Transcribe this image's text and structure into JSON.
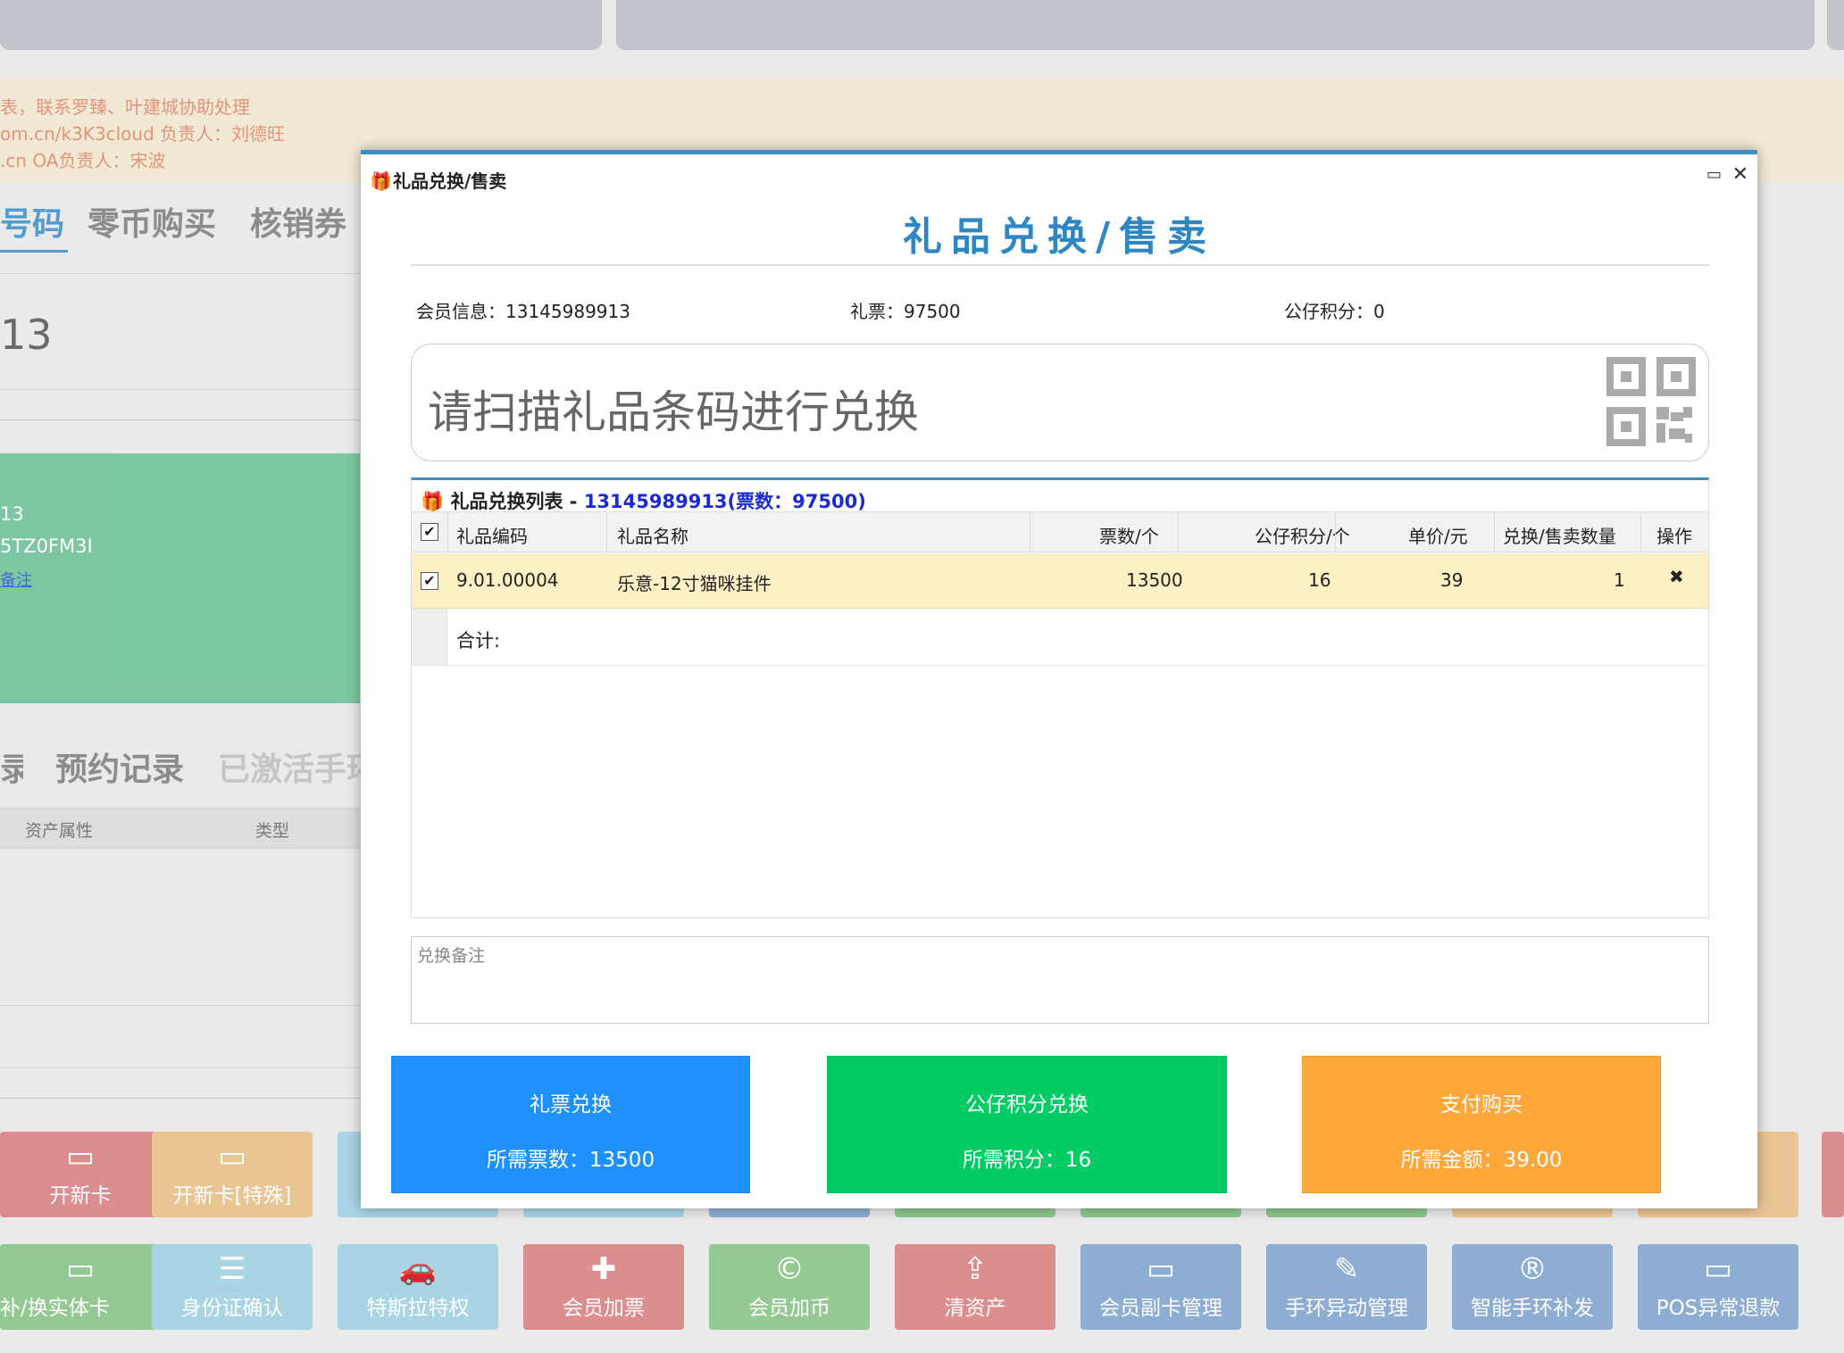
{
  "background": {
    "notice_lines": [
      "表，联系罗臻、叶建城协助处理",
      "om.cn/k3K3cloud 负责人：刘德旺",
      ".cn OA负责人：宋波"
    ],
    "top_tabs": [
      "号码",
      "零币购买",
      "核销券"
    ],
    "member_number_fragment": "13",
    "green_card_lines": [
      "13",
      "5TZ0FM3I"
    ],
    "green_card_link": "备注",
    "record_tabs": [
      "录",
      "预约记录",
      "已激活手环"
    ],
    "table_headers": [
      "资产属性",
      "类型"
    ],
    "tiles_row1": [
      "开新卡",
      "开新卡[特殊]"
    ],
    "tiles_row2": [
      "补/换实体卡",
      "身份证确认",
      "特斯拉特权",
      "会员加票",
      "会员加币",
      "清资产",
      "会员副卡管理",
      "手环异动管理",
      "智能手环补发",
      "POS异常退款"
    ]
  },
  "modal": {
    "window_title": "礼品兑换/售卖",
    "heading": "礼品兑换/售卖",
    "member_info_label": "会员信息：",
    "member_info_value": "13145989913",
    "ticket_label": "礼票：",
    "ticket_value": "97500",
    "points_label": "公仔积分：",
    "points_value": "0",
    "scan_placeholder": "请扫描礼品条码进行兑换",
    "list_title_prefix": "礼品兑换列表 - ",
    "list_title_highlight": "13145989913(票数：97500)",
    "columns": [
      "礼品编码",
      "礼品名称",
      "票数/个",
      "公仔积分/个",
      "单价/元",
      "兑换/售卖数量",
      "操作"
    ],
    "rows": [
      {
        "code": "9.01.00004",
        "name": "乐意-12寸猫咪挂件",
        "tickets": "13500",
        "points": "16",
        "price": "39",
        "qty": "1"
      }
    ],
    "total_label": "合计:",
    "remark_placeholder": "兑换备注",
    "actions": [
      {
        "title": "礼票兑换",
        "detail": "所需票数：13500",
        "color": "#1e90ff"
      },
      {
        "title": "公仔积分兑换",
        "detail": "所需积分：16",
        "color": "#00cc66"
      },
      {
        "title": "支付购买",
        "detail": "所需金额：39.00",
        "color": "#ffa73a"
      }
    ]
  }
}
